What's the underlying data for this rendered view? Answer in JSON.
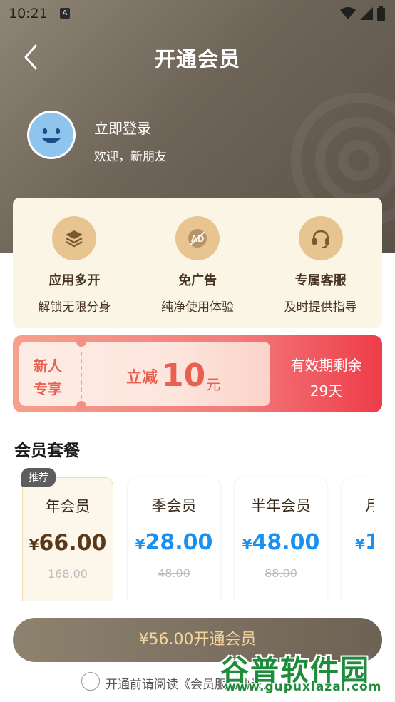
{
  "status_bar": {
    "time": "10:21",
    "notification_badge": "A",
    "icons": [
      "wifi-icon",
      "signal-icon",
      "battery-icon"
    ]
  },
  "header": {
    "title": "开通会员",
    "back_icon": "chevron-left-icon"
  },
  "user": {
    "login_label": "立即登录",
    "welcome": "欢迎，新朋友"
  },
  "features": [
    {
      "icon": "layers-icon",
      "title": "应用多开",
      "desc": "解锁无限分身"
    },
    {
      "icon": "ad-block-icon",
      "title": "免广告",
      "desc": "纯净使用体验"
    },
    {
      "icon": "headset-icon",
      "title": "专属客服",
      "desc": "及时提供指导"
    }
  ],
  "coupon": {
    "tag_line1": "新人",
    "tag_line2": "专享",
    "reduce_label": "立减",
    "amount": "10",
    "unit": "元",
    "validity_label": "有效期剩余",
    "validity_value": "29天"
  },
  "plans_section": {
    "title": "会员套餐",
    "recommend_badge": "推荐",
    "currency": "¥",
    "plans": [
      {
        "name": "年会员",
        "price": "66.00",
        "original": "168.00",
        "selected": true
      },
      {
        "name": "季会员",
        "price": "28.00",
        "original": "48.00",
        "selected": false
      },
      {
        "name": "半年会员",
        "price": "48.00",
        "original": "88.00",
        "selected": false
      },
      {
        "name": "月",
        "price": "1",
        "original": "",
        "selected": false
      }
    ]
  },
  "bottom": {
    "cta_label": "¥56.00开通会员",
    "agreement_text": "开通前请阅读《会员服务协议》"
  },
  "watermark": {
    "title": "谷普软件园",
    "url": "www.gupuxlazal.com"
  },
  "colors": {
    "hero": "#6e6559",
    "gold": "#e8c491",
    "price_blue": "#1a90f0",
    "coupon_red": "#ee3c4a"
  }
}
